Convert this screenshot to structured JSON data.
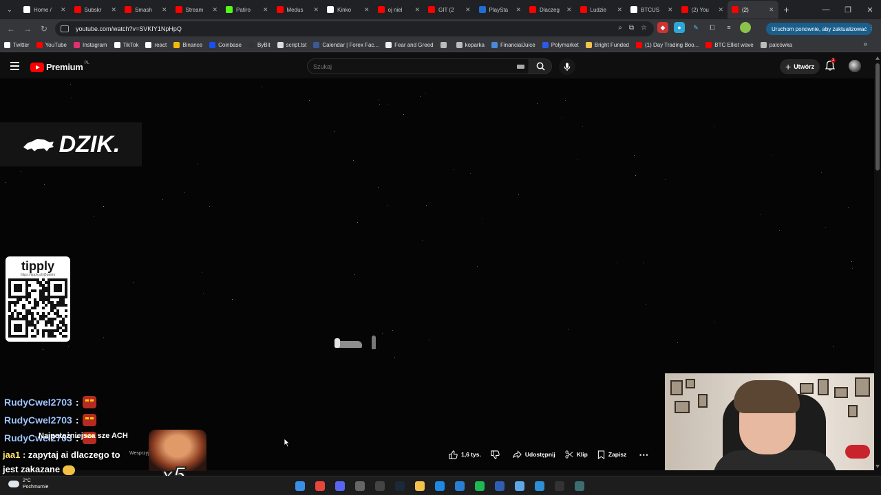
{
  "browser": {
    "tabs": [
      {
        "title": "Home /",
        "icon": "x-icon",
        "color": "#ffffff"
      },
      {
        "title": "Subskr",
        "icon": "youtube-icon",
        "color": "#ff0000"
      },
      {
        "title": "Smash",
        "icon": "youtube-icon",
        "color": "#ff0000"
      },
      {
        "title": "Stream",
        "icon": "youtube-icon",
        "color": "#ff0000"
      },
      {
        "title": "Patiro",
        "icon": "kick-icon",
        "color": "#53fc18"
      },
      {
        "title": "Medus",
        "icon": "youtube-icon",
        "color": "#ff0000"
      },
      {
        "title": "Kinko",
        "icon": "grid-icon",
        "color": "#ffffff"
      },
      {
        "title": "oj niel",
        "icon": "youtube-icon",
        "color": "#ff0000"
      },
      {
        "title": "GIT (2",
        "icon": "youtube-icon",
        "color": "#ff0000"
      },
      {
        "title": "PlaySta",
        "icon": "playstation-icon",
        "color": "#1f6ed4"
      },
      {
        "title": "Dlaczeg",
        "icon": "youtube-icon",
        "color": "#ff0000"
      },
      {
        "title": "Ludzie",
        "icon": "youtube-icon",
        "color": "#ff0000"
      },
      {
        "title": "BTCUS",
        "icon": "tradingview-icon",
        "color": "#ffffff"
      },
      {
        "title": "(2) You",
        "icon": "youtube-icon",
        "color": "#ff0000"
      },
      {
        "title": "(2)",
        "icon": "youtube-icon",
        "color": "#ff0000",
        "active": true
      }
    ],
    "url": "youtube.com/watch?v=SVKIY1NpHpQ",
    "update_label": "Uruchom ponownie, aby zaktualizować",
    "bookmarks": [
      {
        "label": "Twitter",
        "color": "#ffffff"
      },
      {
        "label": "YouTube",
        "color": "#ff0000"
      },
      {
        "label": "Instagram",
        "color": "#e1306c"
      },
      {
        "label": "TikTok",
        "color": "#ffffff"
      },
      {
        "label": "react",
        "color": "#ffffff"
      },
      {
        "label": "Binance",
        "color": "#f0b90b"
      },
      {
        "label": "Coinbase",
        "color": "#1652f0"
      },
      {
        "label": "ByBit",
        "color": "#333333"
      },
      {
        "label": "script.tst",
        "color": "#dddddd"
      },
      {
        "label": "Calendar | Forex Fac...",
        "color": "#3b5998"
      },
      {
        "label": "Fear and Greed",
        "color": "#eeeeee"
      },
      {
        "label": "",
        "color": "#bbbbbb"
      },
      {
        "label": "koparka",
        "color": "#bbbbbb"
      },
      {
        "label": "FinancialJuice",
        "color": "#4a8ad8"
      },
      {
        "label": "Polymarket",
        "color": "#2d5ae8"
      },
      {
        "label": "Bright Funded",
        "color": "#f2c14e"
      },
      {
        "label": "(1) Day Trading Boo...",
        "color": "#ff0000"
      },
      {
        "label": "BTC Elliot wave",
        "color": "#ff0000"
      },
      {
        "label": "palcówka",
        "color": "#bbbbbb"
      }
    ]
  },
  "youtube": {
    "logo_text": "Premium",
    "region": "PL",
    "search_placeholder": "Szukaj",
    "create_label": "Utwórz",
    "notification_count": "2"
  },
  "video": {
    "overlay_logo": "DZIK.",
    "tipply_brand": "tipply",
    "tipply_url": "https://tipply.pl/@patiro",
    "chat": [
      {
        "user": "RudyCwel2703",
        "sep": ":"
      },
      {
        "user": "RudyCwel2703",
        "sep": ":"
      },
      {
        "user": "RudyCwel2703",
        "sep": ":"
      }
    ],
    "overlay_title": "Najpotężniejsza sze                    ACH",
    "support_text": "Wesprzyj",
    "chat2_user": "jaa1",
    "chat2_text": ": zapytaj ai dlaczego to",
    "chat2_text2": "jest zakazane",
    "multiplier": "x5"
  },
  "actions": {
    "like_count": "1,6 tys.",
    "share_label": "Udostępnij",
    "clip_label": "Klip",
    "save_label": "Zapisz"
  },
  "taskbar": {
    "temperature": "2°C",
    "weather": "Pochmurnie",
    "apps": [
      {
        "name": "windows-start-icon",
        "color": "#3a8ee6"
      },
      {
        "name": "chrome-icon",
        "color": "#e8453c"
      },
      {
        "name": "discord-icon",
        "color": "#5865f2"
      },
      {
        "name": "app-icon",
        "color": "#666666"
      },
      {
        "name": "obs-icon",
        "color": "#444444"
      },
      {
        "name": "steam-icon",
        "color": "#1b2838"
      },
      {
        "name": "folder-icon",
        "color": "#f2c14e"
      },
      {
        "name": "edge-icon",
        "color": "#1e88e5"
      },
      {
        "name": "vscode-icon",
        "color": "#2a7fd4"
      },
      {
        "name": "spotify-icon",
        "color": "#1db954"
      },
      {
        "name": "app2-icon",
        "color": "#2f5fb3"
      },
      {
        "name": "notepad-icon",
        "color": "#5fa8e8"
      },
      {
        "name": "photos-icon",
        "color": "#2d8fd5"
      },
      {
        "name": "terminal-icon",
        "color": "#333333"
      },
      {
        "name": "app3-icon",
        "color": "#3c6e71"
      }
    ]
  }
}
